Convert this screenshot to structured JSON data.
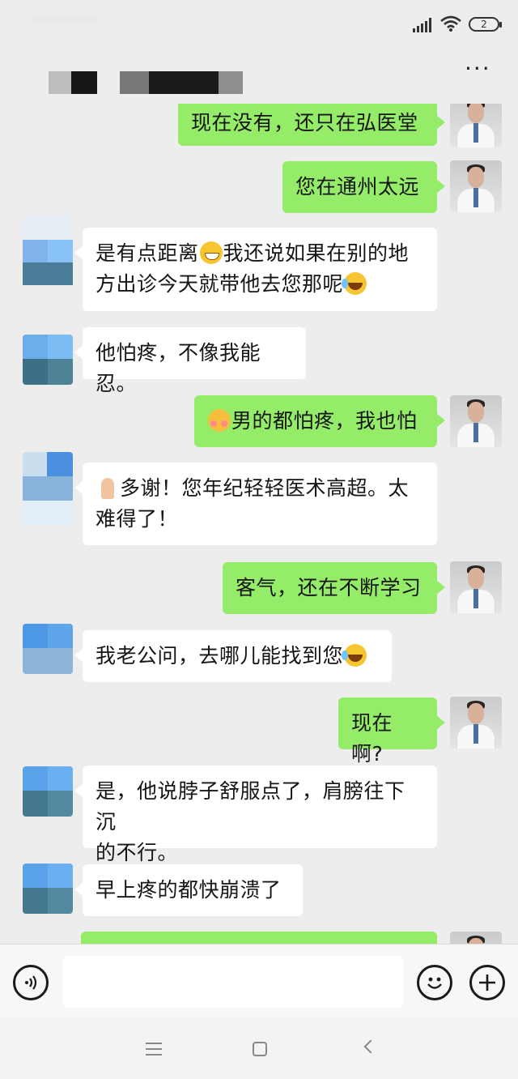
{
  "status_bar": {
    "battery": "2"
  },
  "header": {
    "more_label": "···"
  },
  "messages": [
    {
      "from": "me",
      "text": "现在没有，还只在弘医堂"
    },
    {
      "from": "me",
      "text": "您在通州太远"
    },
    {
      "from": "them",
      "line1_a": "是有点距离",
      "line1_emoji": "grin",
      "line1_b": "我还说如果在别的地",
      "line2_a": "方出诊今天就带他去您那呢",
      "line2_emoji": "laugh"
    },
    {
      "from": "them",
      "text": "他怕疼，不像我能忍。"
    },
    {
      "from": "me",
      "emoji": "shy",
      "text": "男的都怕疼，我也怕"
    },
    {
      "from": "them",
      "emoji": "pray",
      "line1": "多谢！您年纪轻轻医术高超。太",
      "line2": "难得了！"
    },
    {
      "from": "me",
      "text": "客气，还在不断学习"
    },
    {
      "from": "them",
      "text": "我老公问，去哪儿能找到您",
      "emoji": "laugh"
    },
    {
      "from": "me",
      "text": "现在啊?"
    },
    {
      "from": "them",
      "line1": "是，他说脖子舒服点了，肩膀往下沉",
      "line2": "的不行。"
    },
    {
      "from": "them",
      "text": "早上疼的都快崩溃了"
    }
  ],
  "input_bar": {
    "voice_icon": "voice-icon",
    "emoji_icon": "emoji-icon",
    "plus_icon": "plus-icon"
  },
  "nav_bar": {
    "menu_icon": "menu-icon",
    "home_icon": "home-icon",
    "back_icon": "back-icon"
  },
  "colors": {
    "chat_bg": "#ededed",
    "my_bubble": "#95ec69",
    "their_bubble": "#ffffff"
  }
}
